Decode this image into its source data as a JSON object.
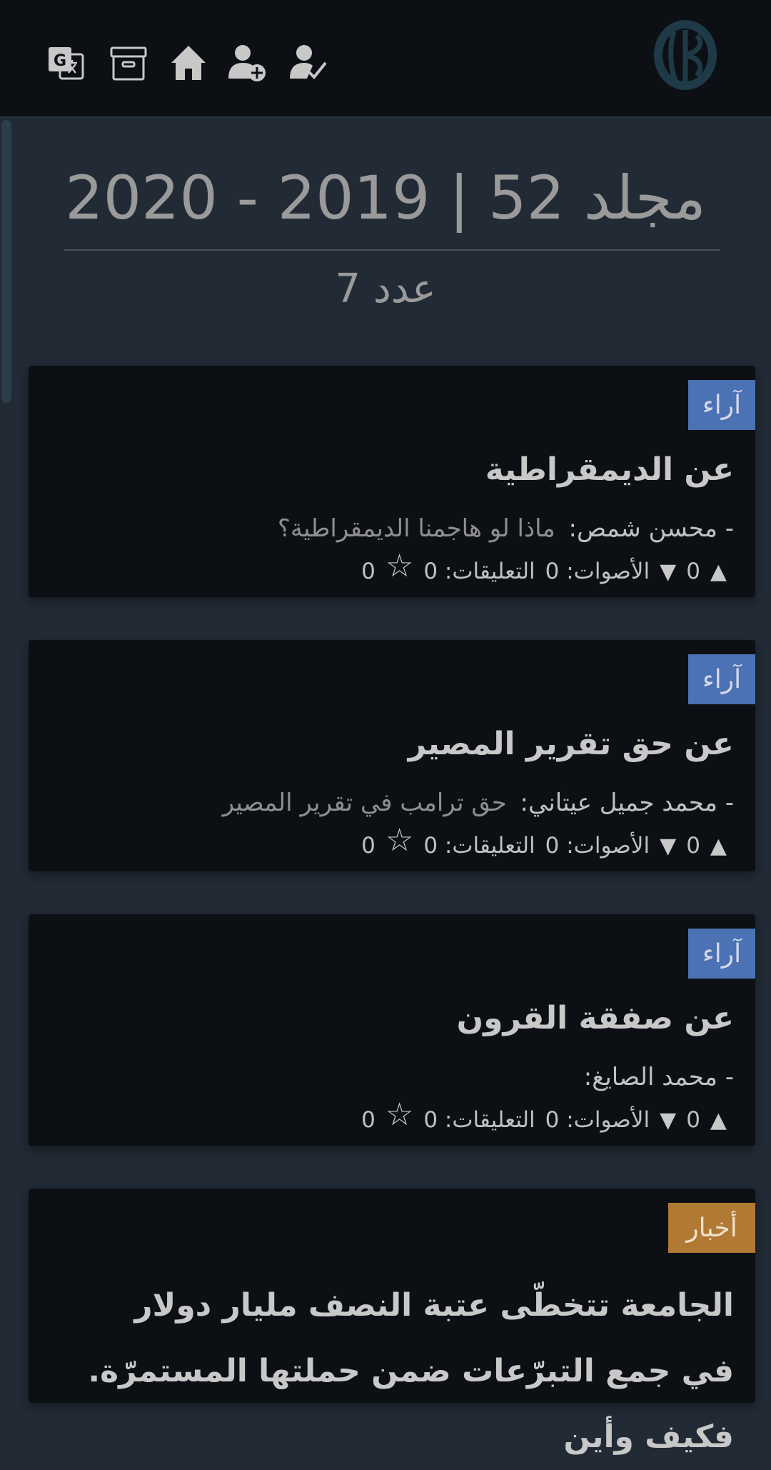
{
  "header": {
    "icons": [
      "translate-icon",
      "archive-icon",
      "home-icon",
      "add-user-icon",
      "user-check-icon",
      "logo"
    ]
  },
  "volume": {
    "title": "مجلد 52 | 2019 - 2020",
    "issue": "عدد 7"
  },
  "cards": [
    {
      "category": "آراء",
      "title": "عن الديمقراطية",
      "author": "- محسن شمص:",
      "subtitle": "ماذا لو هاجمنا الديمقراطية؟",
      "upvotes": "0",
      "downvotes": "0",
      "votes_label": "الأصوات: 0",
      "comments_label": "التعليقات: 0",
      "favorites": "0"
    },
    {
      "category": "آراء",
      "title": "عن حق تقرير المصير",
      "author": "- محمد جميل عيتاني:",
      "subtitle": "حق ترامب في تقرير المصير",
      "upvotes": "0",
      "downvotes": "0",
      "votes_label": "الأصوات: 0",
      "comments_label": "التعليقات: 0",
      "favorites": "0"
    },
    {
      "category": "آراء",
      "title": "عن صفقة القرون",
      "author": "- محمد الصايغ:",
      "subtitle": "",
      "upvotes": "0",
      "downvotes": "0",
      "votes_label": "الأصوات: 0",
      "comments_label": "التعليقات: 0",
      "favorites": "0"
    },
    {
      "category": "أخبار",
      "title": "الجامعة تتخطّى عتبة النصف مليار دولار في جمع التبرّعات ضمن حملتها المستمرّة. فكيف وأين"
    }
  ],
  "colors": {
    "opinion_badge": "#4a72b4",
    "news_badge": "#b07a35",
    "background": "#212a35",
    "card": "#0c1014"
  }
}
